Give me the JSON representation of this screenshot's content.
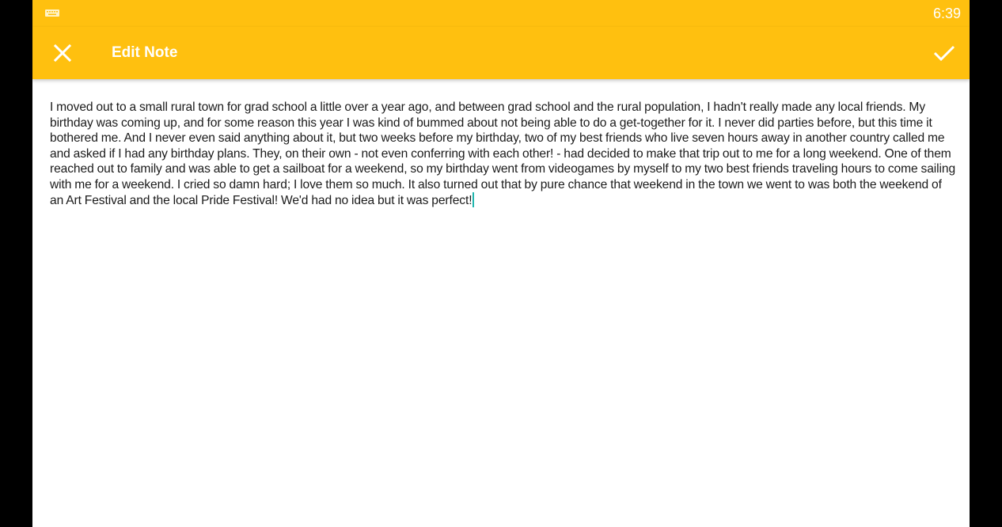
{
  "status_bar": {
    "time": "6:39",
    "keyboard_icon": "keyboard-icon"
  },
  "app_bar": {
    "title": "Edit Note",
    "close_icon": "close-icon",
    "save_icon": "check-icon",
    "background_color": "#ffc00f"
  },
  "note": {
    "text": "I moved out to a small rural town for grad school a little over a year ago, and between grad school and the rural population, I hadn't really made any local friends. My birthday was coming up, and for some reason this year I was kind of bummed about not being able to do a get-together for it. I never did parties before, but this time it bothered me. And I never even said anything about it, but two weeks before my birthday, two of my best friends who live seven hours away in another country called me and asked if I had any birthday plans. They, on their own - not even conferring with each other! - had decided to make that trip out to me for a long weekend. One of them reached out to family and was able to get a sailboat for a weekend, so my birthday went from videogames by myself to my two best friends traveling hours to come sailing with me for a weekend. I cried so damn hard; I love them so much. It also turned out that by pure chance that weekend in the town we went to was both the weekend of an Art Festival and the local Pride Festival! We'd had no idea but it was perfect!"
  }
}
